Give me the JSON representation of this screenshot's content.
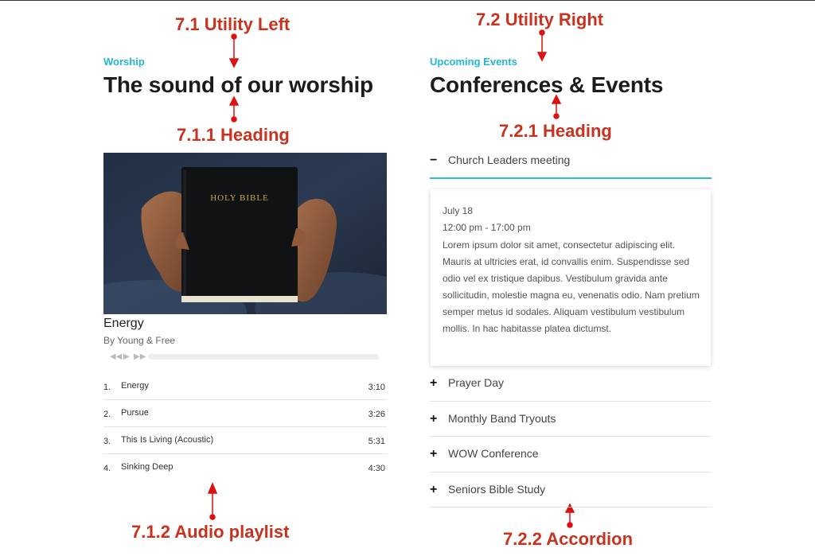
{
  "annotations": {
    "utility_left": "7.1 Utility Left",
    "utility_right": "7.2 Utility Right",
    "heading_left": "7.1.1 Heading",
    "heading_right": "7.2.1 Heading",
    "audio_playlist": "7.1.2 Audio playlist",
    "accordion": "7.2.2 Accordion"
  },
  "colors": {
    "accent": "#22b8d4",
    "annotation": "#c8321e",
    "heading": "#1c1c1c"
  },
  "left": {
    "eyebrow": "Worship",
    "heading": "The sound of our worship",
    "image_text": "HOLY BIBLE",
    "now_playing": {
      "title": "Energy",
      "artist": "By Young & Free"
    },
    "player_icons": [
      "rewind-icon",
      "play-icon",
      "fast-forward-icon"
    ],
    "playlist": [
      {
        "num": "1.",
        "name": "Energy",
        "duration": "3:10"
      },
      {
        "num": "2.",
        "name": "Pursue",
        "duration": "3:26"
      },
      {
        "num": "3.",
        "name": "This Is Living (Acoustic)",
        "duration": "5:31"
      },
      {
        "num": "4.",
        "name": "Sinking Deep",
        "duration": "4:30"
      }
    ]
  },
  "right": {
    "eyebrow": "Upcoming Events",
    "heading": "Conferences & Events",
    "accordion": [
      {
        "symbol": "−",
        "label": "Church Leaders meeting",
        "expanded": true
      },
      {
        "symbol": "+",
        "label": "Prayer Day",
        "expanded": false
      },
      {
        "symbol": "+",
        "label": "Monthly Band Tryouts",
        "expanded": false
      },
      {
        "symbol": "+",
        "label": "WOW Conference",
        "expanded": false
      },
      {
        "symbol": "+",
        "label": "Seniors Bible Study",
        "expanded": false
      }
    ],
    "panel": {
      "date": "July 18",
      "time": "12:00 pm - 17:00 pm",
      "body": "Lorem ipsum dolor sit amet, consectetur adipiscing elit. Mauris at ultricies erat, id convallis enim. Suspendisse sed odio vel ex tristique dapibus. Vestibulum gravida ante sollicitudin, molestie magna eu, venenatis odio. Nam pretium semper metus id sodales. Aliquam vestibulum vestibulum mollis. In hac habitasse platea dictumst."
    }
  }
}
